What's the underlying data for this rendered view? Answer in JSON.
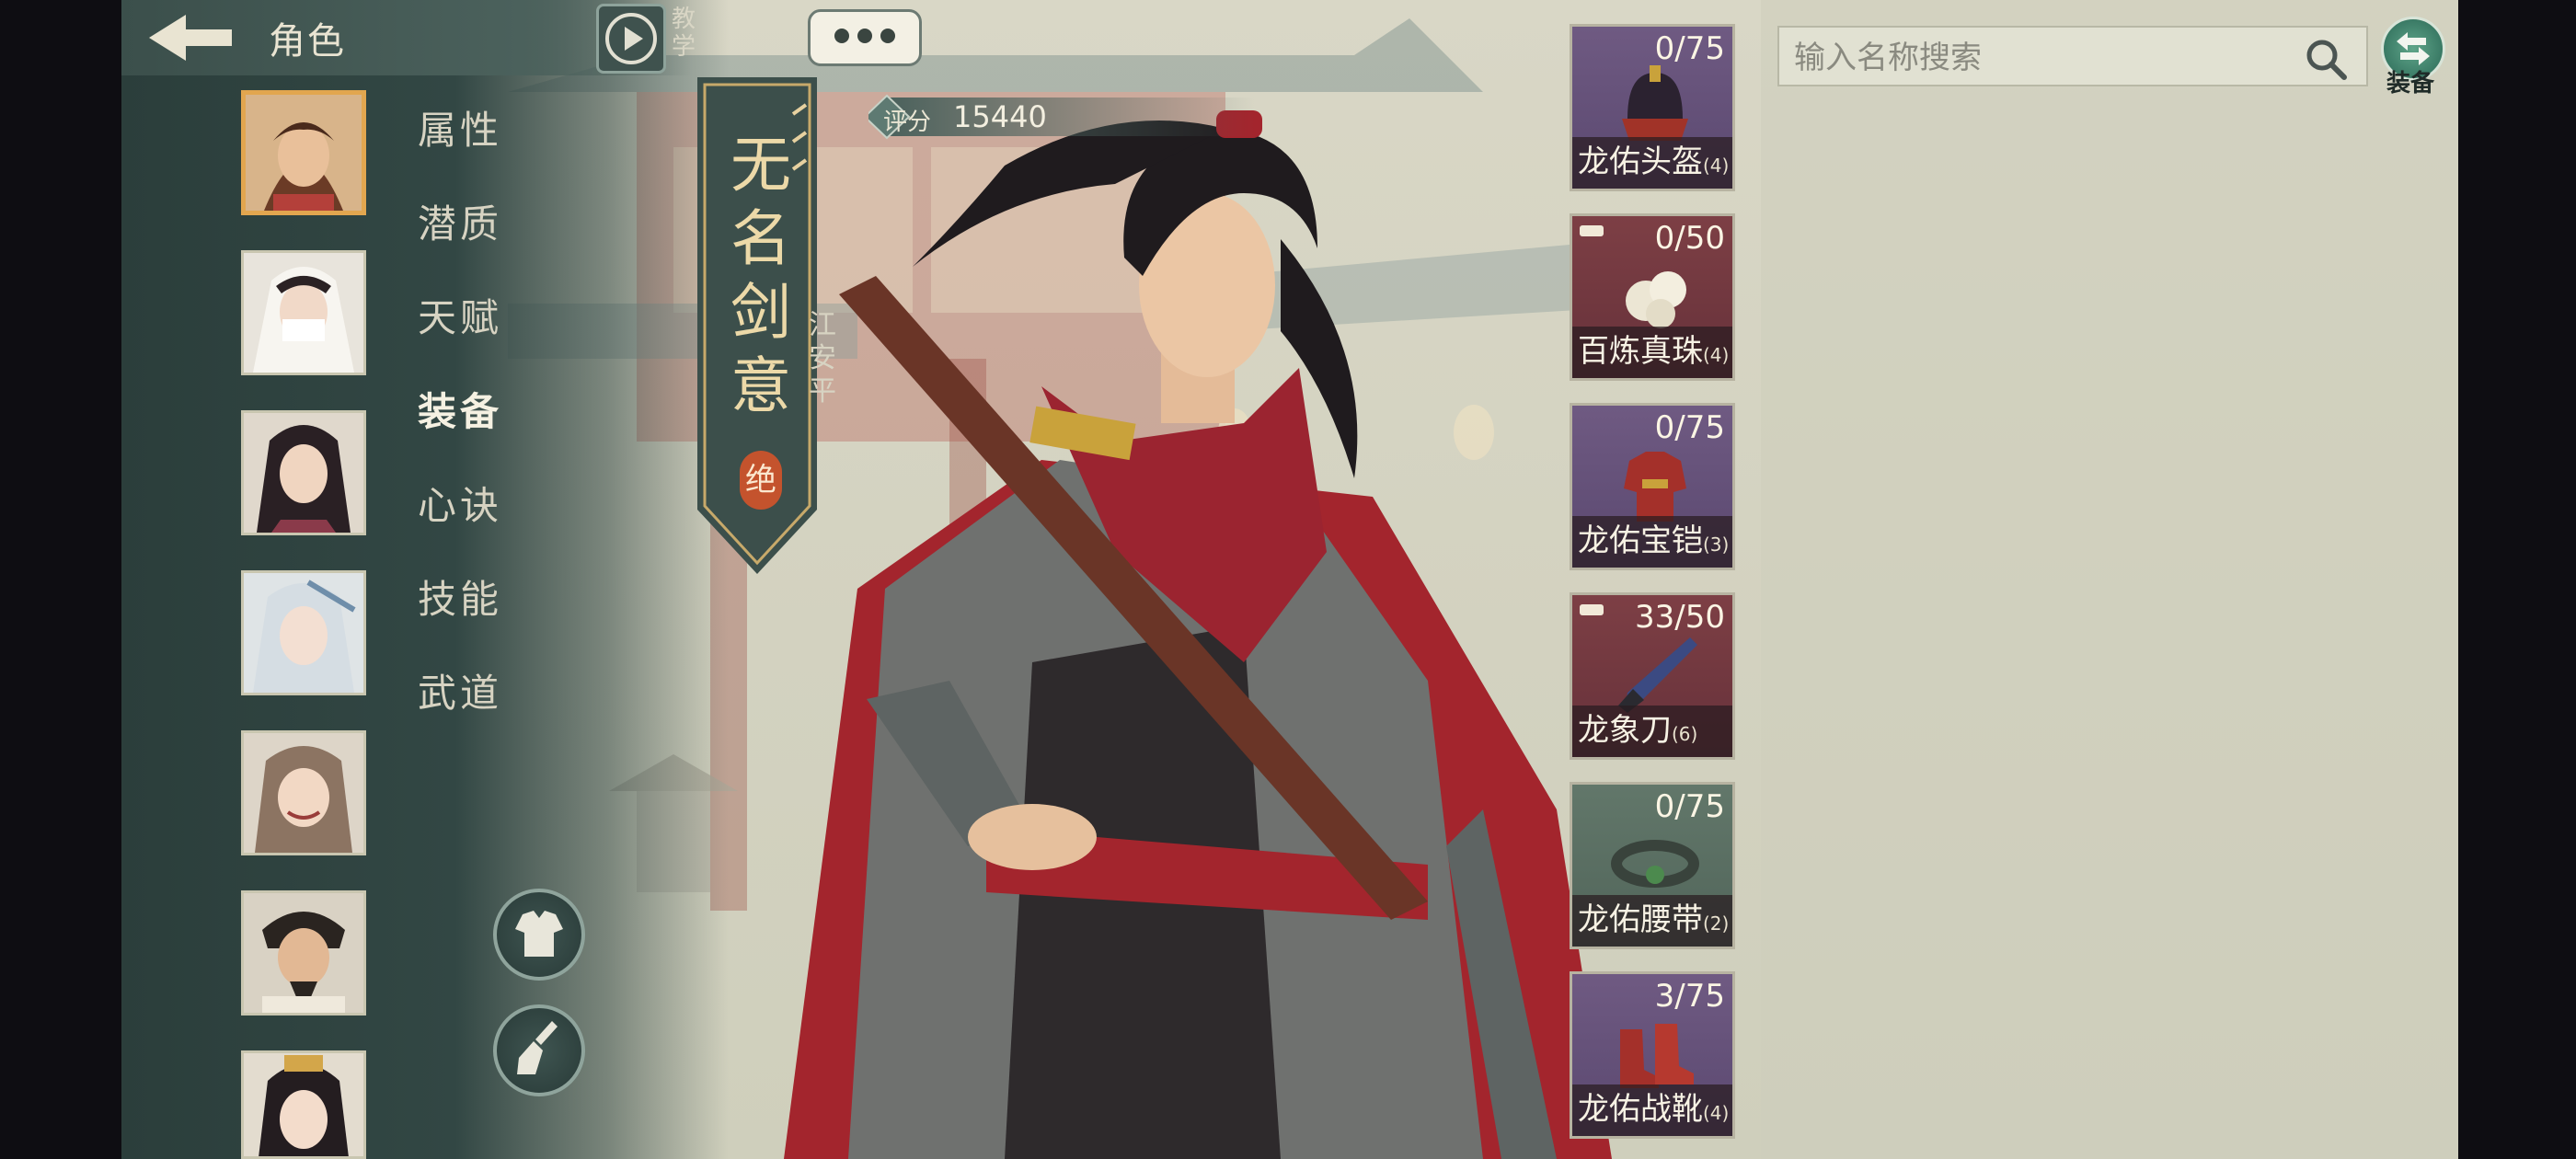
{
  "header": {
    "title": "角色",
    "tutorial_label": "教学"
  },
  "sidebar": {
    "tabs": [
      {
        "label": "属性"
      },
      {
        "label": "潜质"
      },
      {
        "label": "天赋"
      },
      {
        "label": "装备"
      },
      {
        "label": "心诀"
      },
      {
        "label": "技能"
      },
      {
        "label": "武道"
      }
    ],
    "active_tab": "装备"
  },
  "character": {
    "banner_title": "无名剑意",
    "name": "江安平",
    "grade": "绝",
    "score_label": "评分",
    "score_value": "15440"
  },
  "equipment": [
    {
      "name": "龙佑头盔",
      "level": "(4)",
      "count": "0/75",
      "color": "purple",
      "icon": "helmet-icon"
    },
    {
      "name": "百炼真珠",
      "level": "(4)",
      "count": "0/50",
      "color": "red",
      "icon": "pearl-icon"
    },
    {
      "name": "龙佑宝铠",
      "level": "(3)",
      "count": "0/75",
      "color": "purple",
      "icon": "armor-icon"
    },
    {
      "name": "龙象刀",
      "level": "(6)",
      "count": "33/50",
      "color": "red",
      "icon": "blade-icon"
    },
    {
      "name": "龙佑腰带",
      "level": "(2)",
      "count": "0/75",
      "color": "green",
      "icon": "belt-icon"
    },
    {
      "name": "龙佑战靴",
      "level": "(4)",
      "count": "3/75",
      "color": "purple",
      "icon": "boots-icon"
    }
  ],
  "search": {
    "placeholder": "输入名称搜索"
  },
  "equip_switch_label": "装备",
  "colors": {
    "accent": "#e2a64f",
    "sidebar": "#324744",
    "grade": "#c4532d",
    "scarf": "#a3252d"
  }
}
